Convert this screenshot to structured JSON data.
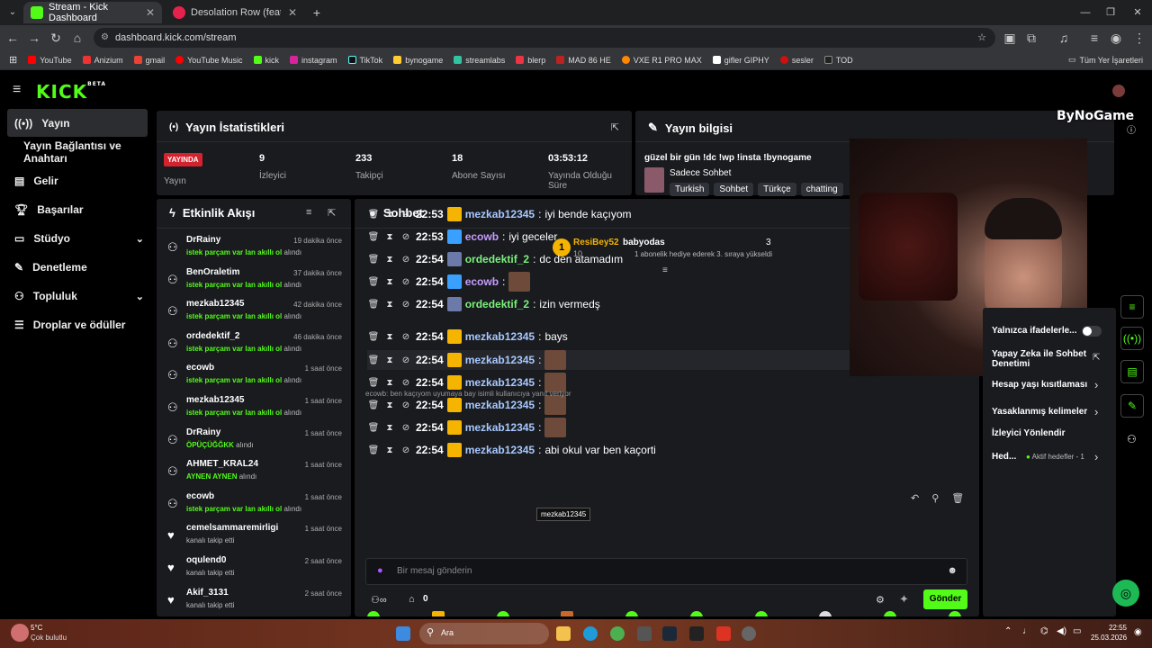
{
  "browser": {
    "tabs": [
      {
        "title": "Stream - Kick Dashboard",
        "active": true
      },
      {
        "title": "Desolation Row (feat. Les D",
        "active": false
      }
    ],
    "url": "dashboard.kick.com/stream",
    "bookmarks": [
      "YouTube",
      "Anizium",
      "gmail",
      "YouTube Music",
      "kick",
      "instagram",
      "TikTok",
      "bynogame",
      "streamlabs",
      "blerp",
      "MAD 86 HE",
      "VXE R1 PRO MAX",
      "gifler GIPHY",
      "sesler",
      "TOD"
    ],
    "all_bookmarks": "Tüm Yer İşaretleri"
  },
  "app": {
    "logo": "KICK",
    "logo_badge": "BETA",
    "nav": [
      {
        "label": "Yayın",
        "icon": "broadcast-icon",
        "active": true
      },
      {
        "label": "Yayın Bağlantısı ve Anahtarı",
        "icon": "",
        "active": false
      },
      {
        "label": "Gelir",
        "icon": "revenue-icon",
        "active": false
      },
      {
        "label": "Başarılar",
        "icon": "trophy-icon",
        "active": false
      },
      {
        "label": "Stüdyo",
        "icon": "studio-icon",
        "active": false,
        "chevron": true
      },
      {
        "label": "Denetleme",
        "icon": "wrench-icon",
        "active": false
      },
      {
        "label": "Topluluk",
        "icon": "community-icon",
        "active": false,
        "chevron": true
      },
      {
        "label": "Droplar ve ödüller",
        "icon": "drops-icon",
        "active": false
      }
    ]
  },
  "stats": {
    "title": "Yayın İstatistikleri",
    "live": "YAYINDA",
    "live_label": "Yayın",
    "items": [
      {
        "value": "9",
        "label": "İzleyici"
      },
      {
        "value": "233",
        "label": "Takipçi"
      },
      {
        "value": "18",
        "label": "Abone Sayısı"
      },
      {
        "value": "03:53:12",
        "label": "Yayında Olduğu Süre"
      }
    ]
  },
  "info": {
    "title": "Yayın bilgisi",
    "stream_title": "güzel bir gün !dc !wp !insta !bynogame",
    "category": "Sadece Sohbet",
    "tags": [
      "Turkish",
      "Sohbet",
      "Türkçe",
      "chatting"
    ],
    "overlay_brand": "ByNoGame"
  },
  "activity": {
    "title": "Etkinlik Akışı",
    "items": [
      {
        "name": "DrRainy",
        "desc": "istek parçam var lan akıllı ol",
        "suffix": "alındı",
        "time": "19 dakika önce",
        "icon": "redeem-icon"
      },
      {
        "name": "BenOraletim",
        "desc": "istek parçam var lan akıllı ol",
        "suffix": "alındı",
        "time": "37 dakika önce",
        "icon": "redeem-icon"
      },
      {
        "name": "mezkab12345",
        "desc": "istek parçam var lan akıllı ol",
        "suffix": "alındı",
        "time": "42 dakika önce",
        "icon": "redeem-icon"
      },
      {
        "name": "ordedektif_2",
        "desc": "istek parçam var lan akıllı ol",
        "suffix": "alındı",
        "time": "46 dakika önce",
        "icon": "redeem-icon"
      },
      {
        "name": "ecowb",
        "desc": "istek parçam var lan akıllı ol",
        "suffix": "alındı",
        "time": "1 saat önce",
        "icon": "redeem-icon"
      },
      {
        "name": "mezkab12345",
        "desc": "istek parçam var lan akıllı ol",
        "suffix": "alındı",
        "time": "1 saat önce",
        "icon": "redeem-icon"
      },
      {
        "name": "DrRainy",
        "desc": "ÖPÜÇÜĞĞKK",
        "suffix": "alındı",
        "time": "1 saat önce",
        "icon": "redeem-icon"
      },
      {
        "name": "AHMET_KRAL24",
        "desc": "AYNEN AYNEN",
        "suffix": "alındı",
        "time": "1 saat önce",
        "icon": "redeem-icon"
      },
      {
        "name": "ecowb",
        "desc": "istek parçam var lan akıllı ol",
        "suffix": "alındı",
        "time": "1 saat önce",
        "icon": "redeem-icon"
      },
      {
        "name": "cemelsammaremirligi",
        "desc": "",
        "suffix": "kanalı takip etti",
        "time": "1 saat önce",
        "icon": "heart-icon"
      },
      {
        "name": "oqulend0",
        "desc": "",
        "suffix": "kanalı takip etti",
        "time": "2 saat önce",
        "icon": "heart-icon"
      },
      {
        "name": "Akif_3131",
        "desc": "",
        "suffix": "kanalı takip etti",
        "time": "2 saat önce",
        "icon": "heart-icon"
      }
    ]
  },
  "chat": {
    "title": "Sohbet",
    "pinned": {
      "rank": "1",
      "user": "ResiBey52",
      "count": "10",
      "user2": "babyodas",
      "count2": "3",
      "note": "1 abonelik hediye ederek 3. sıraya yükseldi"
    },
    "messages": [
      {
        "time": "22:53",
        "user": "mezkab12345",
        "text": "iyi bende kaçıyom",
        "color": "#a8c8ff"
      },
      {
        "time": "22:53",
        "user": "ecowb",
        "text": "iyi geceler",
        "color": "#c89cff"
      },
      {
        "time": "22:54",
        "user": "ordedektif_2",
        "text": "dc den atamadım",
        "color": "#7cf27c"
      },
      {
        "time": "22:54",
        "user": "ecowb",
        "text": "",
        "color": "#c89cff"
      },
      {
        "time": "22:54",
        "user": "ordedektif_2",
        "text": "izin vermedş",
        "color": "#7cf27c"
      },
      {
        "time": "22:54",
        "user": "mezkab12345",
        "text": "bays",
        "color": "#a8c8ff"
      },
      {
        "time": "22:54",
        "user": "mezkab12345",
        "text": "",
        "color": "#a8c8ff"
      },
      {
        "time": "22:54",
        "user": "mezkab12345",
        "text": "",
        "color": "#a8c8ff"
      },
      {
        "time": "22:54",
        "user": "mezkab12345",
        "text": "",
        "color": "#a8c8ff"
      },
      {
        "time": "22:54",
        "user": "mezkab12345",
        "text": "",
        "color": "#a8c8ff"
      },
      {
        "time": "22:54",
        "user": "mezkab12345",
        "text": "abi okul var ben kaçorti",
        "color": "#a8c8ff"
      }
    ],
    "reply_hint": "ecowb: ben kaçıyom uyumaya bay isimli kullanıcıya yanıt veriyor",
    "tooltip": "mezkab12345",
    "input_placeholder": "Bir mesaj gönderin",
    "points": "0",
    "send": "Gönder"
  },
  "settings": {
    "items": [
      "Yalnızca ifadelerle...",
      "Yapay Zeka ile Sohbet Denetimi",
      "Hesap yaşı kısıtlaması",
      "Yasaklanmış kelimeler",
      "İzleyici Yönlendir",
      "Hed..."
    ],
    "goals": "Aktif hedefler - 1"
  },
  "taskbar": {
    "weather_temp": "5°C",
    "weather_desc": "Çok bulutlu",
    "search": "Ara",
    "time": "22:55",
    "date": "25.03.2026"
  },
  "colors": {
    "accent": "#53fc18",
    "live": "#d4232e",
    "panel": "#191b1f"
  }
}
